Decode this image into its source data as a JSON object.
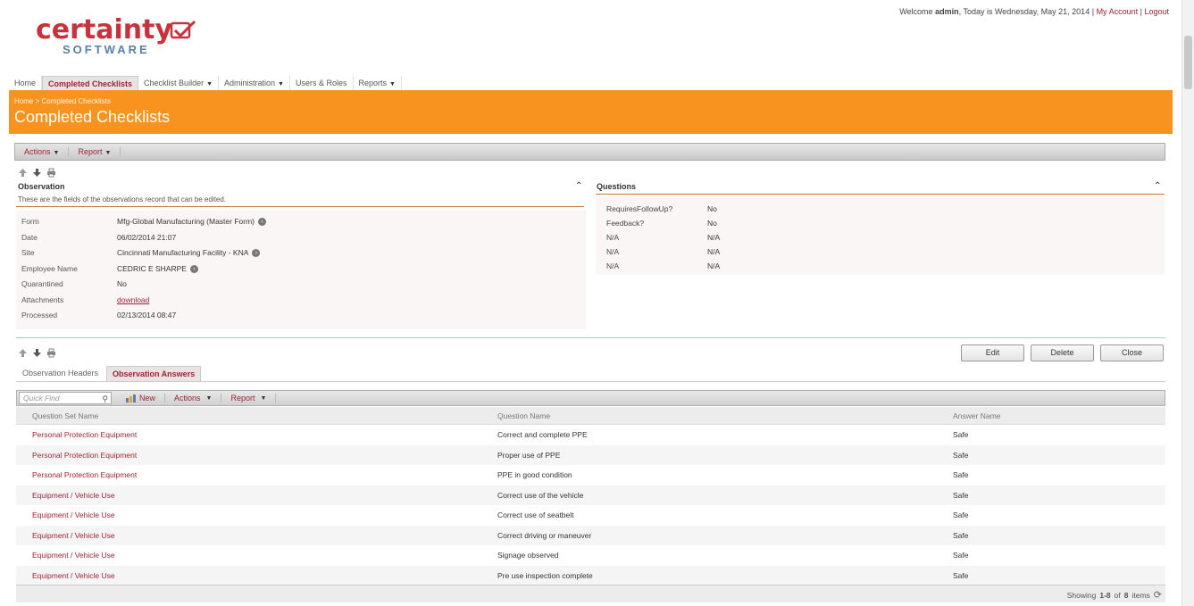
{
  "header": {
    "welcome_prefix": "Welcome",
    "user": "admin",
    "date_text": ", Today is Wednesday, May 21, 2014 |",
    "my_account": "My Account",
    "sep": "|",
    "logout": "Logout"
  },
  "logo": {
    "main": "certainty",
    "sub": "SOFTWARE"
  },
  "nav": {
    "items": [
      {
        "label": "Home"
      },
      {
        "label": "Completed Checklists"
      },
      {
        "label": "Checklist Builder"
      },
      {
        "label": "Administration"
      },
      {
        "label": "Users & Roles"
      },
      {
        "label": "Reports"
      }
    ]
  },
  "banner": {
    "crumb_home": "Home",
    "crumb_sep": ">",
    "crumb_current": "Completed Checklists",
    "title": "Completed Checklists"
  },
  "toolbar": {
    "actions": "Actions",
    "report": "Report"
  },
  "observation": {
    "title": "Observation",
    "description": "These are the fields of the observations record that can be edited.",
    "fields": [
      {
        "label": "Form",
        "value": "Mfg-Global Manufacturing (Master Form)"
      },
      {
        "label": "Date",
        "value": "06/02/2014 21:07"
      },
      {
        "label": "Site",
        "value": "Cincinnati Manufacturing Facility - KNA"
      },
      {
        "label": "Employee Name",
        "value": "CEDRIC E SHARPE"
      },
      {
        "label": "Quarantined",
        "value": "No"
      },
      {
        "label": "Attachments",
        "value": "download"
      },
      {
        "label": "Processed",
        "value": "02/13/2014 08:47"
      }
    ]
  },
  "questions": {
    "title": "Questions",
    "rows": [
      {
        "label": "RequiresFollowUp?",
        "value": "No"
      },
      {
        "label": "Feedback?",
        "value": "No"
      },
      {
        "label": "N/A",
        "value": "N/A"
      },
      {
        "label": "N/A",
        "value": "N/A"
      },
      {
        "label": "N/A",
        "value": "N/A"
      }
    ]
  },
  "buttons": {
    "edit": "Edit",
    "delete": "Delete",
    "close": "Close"
  },
  "tabs": {
    "headers": "Observation Headers",
    "answers": "Observation Answers"
  },
  "grid_toolbar": {
    "quick_find_placeholder": "Quick Find",
    "new": "New",
    "actions": "Actions",
    "report": "Report"
  },
  "grid": {
    "columns": [
      "Question Set Name",
      "Question Name",
      "Answer Name"
    ],
    "rows": [
      [
        "Personal Protection Equipment",
        "Correct and complete PPE",
        "Safe"
      ],
      [
        "Personal Protection Equipment",
        "Proper use of PPE",
        "Safe"
      ],
      [
        "Personal Protection Equipment",
        "PPE in good condition",
        "Safe"
      ],
      [
        "Equipment / Vehicle Use",
        "Correct use of the vehicle",
        "Safe"
      ],
      [
        "Equipment / Vehicle Use",
        "Correct use of seatbelt",
        "Safe"
      ],
      [
        "Equipment / Vehicle Use",
        "Correct driving or maneuver",
        "Safe"
      ],
      [
        "Equipment / Vehicle Use",
        "Signage observed",
        "Safe"
      ],
      [
        "Equipment / Vehicle Use",
        "Pre use inspection complete",
        "Safe"
      ]
    ],
    "paging_prefix": "Showing",
    "paging_range": "1-8",
    "paging_of": "of",
    "paging_total": "8",
    "paging_suffix": "items"
  },
  "colors": {
    "accent": "#f7931e",
    "link": "#9b2335"
  }
}
